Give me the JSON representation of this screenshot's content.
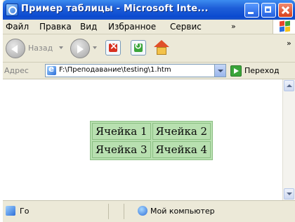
{
  "window": {
    "title": "Пример таблицы - Microsoft Inte..."
  },
  "menu": {
    "items": [
      "Файл",
      "Правка",
      "Вид",
      "Избранное",
      "Сервис"
    ],
    "more": "»"
  },
  "toolbar": {
    "back_label": "Назад",
    "more": "»"
  },
  "address": {
    "label": "Адрес",
    "value": "F:\\Преподавание\\testing\\1.htm",
    "go_label": "Переход"
  },
  "table": {
    "rows": [
      [
        "Ячейка 1",
        "Ячейка 2"
      ],
      [
        "Ячейка 3",
        "Ячейка 4"
      ]
    ]
  },
  "status": {
    "text": "Го",
    "zone": "Мой компьютер"
  },
  "colors": {
    "cell_bg": "#b8e0b0",
    "title_bar": "#0b4ad0"
  }
}
